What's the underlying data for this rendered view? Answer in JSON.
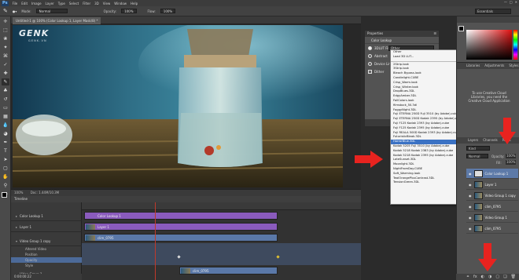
{
  "menu": {
    "app_logo": "Ps",
    "items": [
      "File",
      "Edit",
      "Image",
      "Layer",
      "Type",
      "Select",
      "Filter",
      "3D",
      "View",
      "Window",
      "Help"
    ]
  },
  "options": {
    "mode_label": "Mode:",
    "mode_value": "Normal",
    "opacity_label": "Opacity:",
    "opacity_value": "100%",
    "flow_label": "Flow:",
    "flow_value": "100%",
    "workspace": "Essentials"
  },
  "document": {
    "tab_title": "Untitled-1 @ 100% (Color Lookup 1, Layer Mask/8) *",
    "watermark_logo": "GENK",
    "watermark_sub": "G E N K . V N",
    "status_zoom": "100%",
    "status_doc": "Doc: 1.44M/10.3M"
  },
  "timeline": {
    "title": "Timeline",
    "tracks": [
      {
        "label": "Color Lookup 1"
      },
      {
        "label": "Layer 1"
      },
      {
        "label": "Video Group 1 copy"
      },
      {
        "label": "Video Group 1"
      }
    ],
    "sub_rows": [
      "Altered Video",
      "Position",
      "Opacity",
      "Style"
    ],
    "time_display": "0:00:00:22",
    "clips": [
      "Color Lookup 1",
      "Layer 1",
      "clim_0795",
      "clim_0795"
    ]
  },
  "properties": {
    "title": "Properties",
    "subtitle": "Color Lookup",
    "rows": [
      {
        "label": "3DLUT File",
        "value": "Other"
      },
      {
        "label": "Abstract",
        "value": ""
      },
      {
        "label": "Device Link",
        "value": ""
      },
      {
        "label": "Dither",
        "value": ""
      }
    ]
  },
  "lut_dropdown": {
    "items": [
      "Other",
      "Load 3D LUT...",
      "",
      "2Strip.look",
      "3Strip.look",
      "Bleach Bypass.look",
      "Candlelight.CUBE",
      "Crisp_Warm.look",
      "Crisp_Winter.look",
      "DropBlues.3DL",
      "EdgyAmber.3DL",
      "FallColors.look",
      "filmstock_50.3dl",
      "FoggyNight.3DL",
      "Fuji ETERNA 250D Fuji 3510 (by Adobe).cube",
      "Fuji ETERNA 250D Kodak 2395 (by Adobe).cube",
      "Fuji F125 Kodak 2393 (by Adobe).cube",
      "Fuji F125 Kodak 2395 (by Adobe).cube",
      "Fuji REALA 500D Kodak 2393 (by Adobe).cube",
      "FuturisticBleak.3DL",
      "HorrorBlue.3DL",
      "Kodak 5205 Fuji 3510 (by Adobe).cube",
      "Kodak 5218 Kodak 2383 (by Adobe).cube",
      "Kodak 5218 Kodak 2395 (by Adobe).cube",
      "LateSunset.3DL",
      "Moonlight.3DL",
      "NightFromDay.CUBE",
      "Soft_Warming.look",
      "TealOrangePlusContrast.3DL",
      "TensionGreen.3DL"
    ],
    "selected": "HorrorBlue.3DL"
  },
  "libraries": {
    "tabs": [
      "Libraries",
      "Adjustments",
      "Styles"
    ],
    "cloud_message": "To use Creative Cloud Libraries, you need the Creative Cloud Application"
  },
  "layers": {
    "tabs": [
      "Layers",
      "Channels",
      "Paths"
    ],
    "kind_label": "Kind",
    "blend_value": "Normal",
    "opacity_label": "Opacity:",
    "opacity_value": "100%",
    "fill_label": "Fill:",
    "fill_value": "100%",
    "rows": [
      {
        "name": "Color Lookup 1",
        "selected": true
      },
      {
        "name": "Layer 1",
        "selected": false
      },
      {
        "name": "Video Group 1 copy",
        "selected": false
      },
      {
        "name": "clim_0795",
        "selected": false
      },
      {
        "name": "Video Group 1",
        "selected": false
      },
      {
        "name": "clim_0795",
        "selected": false
      }
    ]
  },
  "colors": {
    "accent_arrow": "#e8231f",
    "selection_blue": "#3b72c4",
    "clip_purple": "#8a5bbd",
    "clip_blue": "#5a78a8"
  }
}
